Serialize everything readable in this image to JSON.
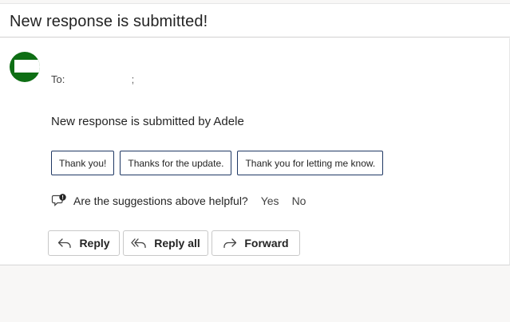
{
  "header": {
    "subject": "New response is submitted!"
  },
  "message": {
    "to_label": "To:",
    "to_separator": ";",
    "body": "New response is submitted by Adele"
  },
  "suggested_replies": [
    {
      "label": "Thank you!"
    },
    {
      "label": "Thanks for the update."
    },
    {
      "label": "Thank you for letting me know."
    }
  ],
  "feedback": {
    "question": "Are the suggestions above helpful?",
    "yes": "Yes",
    "no": "No"
  },
  "actions": {
    "reply": "Reply",
    "reply_all": "Reply all",
    "forward": "Forward"
  },
  "colors": {
    "avatar": "#0e6e14",
    "chip_border": "#1f3864"
  }
}
